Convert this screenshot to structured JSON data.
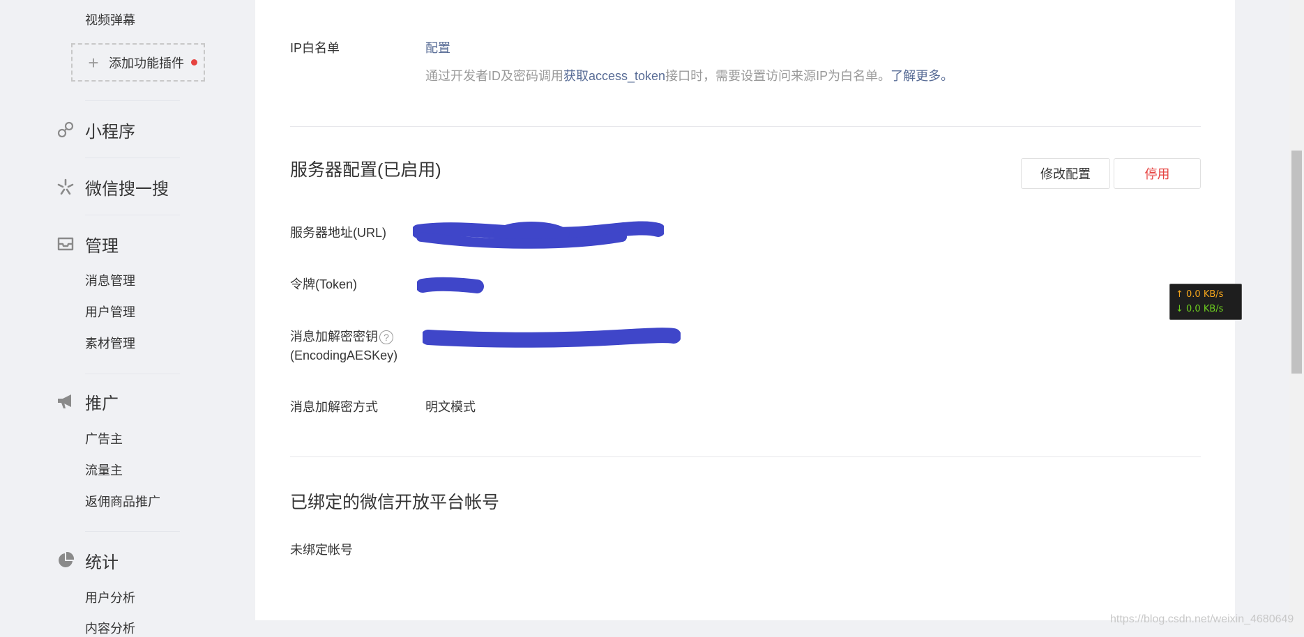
{
  "sidebar": {
    "top_item": "视频弹幕",
    "add_plugin_label": "添加功能插件",
    "groups": [
      {
        "label": "小程序",
        "icon": "link-icon"
      },
      {
        "label": "微信搜一搜",
        "icon": "search-spark-icon"
      },
      {
        "label": "管理",
        "icon": "inbox-icon",
        "items": [
          "消息管理",
          "用户管理",
          "素材管理"
        ]
      },
      {
        "label": "推广",
        "icon": "megaphone-icon",
        "items": [
          "广告主",
          "流量主",
          "返佣商品推广"
        ]
      },
      {
        "label": "统计",
        "icon": "pie-chart-icon",
        "items": [
          "用户分析",
          "内容分析"
        ]
      }
    ]
  },
  "ip_whitelist": {
    "label": "IP白名单",
    "config_link": "配置",
    "desc_prefix": "通过开发者ID及密码调用",
    "desc_link": "获取access_token",
    "desc_suffix": "接口时，需要设置访问来源IP为白名单。",
    "learn_more": "了解更多。"
  },
  "server_config": {
    "title": "服务器配置(已启用)",
    "modify_button": "修改配置",
    "disable_button": "停用",
    "url_label": "服务器地址(URL)",
    "token_label": "令牌(Token)",
    "aes_label_line1": "消息加解密密钥",
    "aes_label_line2": "(EncodingAESKey)",
    "help_glyph": "?",
    "mode_label": "消息加解密方式",
    "mode_value": "明文模式"
  },
  "bound_accounts": {
    "title": "已绑定的微信开放平台帐号",
    "status": "未绑定帐号"
  },
  "speed_widget": {
    "up": "↑ 0.0 KB/s",
    "down": "↓ 0.0 KB/s"
  },
  "watermark": "https://blog.csdn.net/weixin_4680649",
  "colors": {
    "link": "#576b95",
    "danger": "#e64340",
    "redaction": "#3f46c9"
  }
}
